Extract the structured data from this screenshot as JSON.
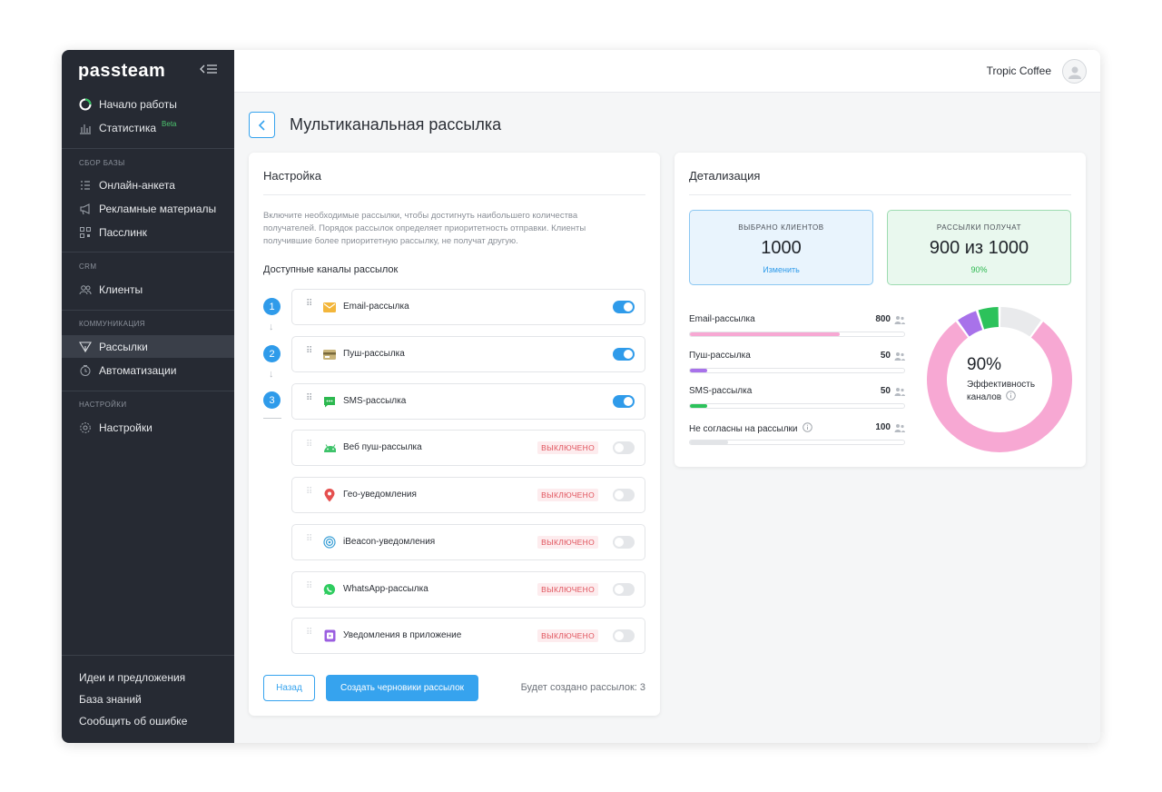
{
  "app": {
    "logo": "passteam",
    "company": "Tropic Coffee"
  },
  "sidebar": {
    "top_items": [
      {
        "label": "Начало работы",
        "icon": "power-icon"
      },
      {
        "label": "Статистика",
        "icon": "bar-chart-icon",
        "badge": "Beta"
      }
    ],
    "sections": [
      {
        "title": "СБОР БАЗЫ",
        "items": [
          {
            "label": "Онлайн-анкета",
            "icon": "form-icon"
          },
          {
            "label": "Рекламные материалы",
            "icon": "megaphone-icon"
          },
          {
            "label": "Пасслинк",
            "icon": "qr-icon"
          }
        ]
      },
      {
        "title": "CRM",
        "items": [
          {
            "label": "Клиенты",
            "icon": "users-icon"
          }
        ]
      },
      {
        "title": "КОММУНИКАЦИЯ",
        "items": [
          {
            "label": "Рассылки",
            "icon": "send-icon",
            "active": true
          },
          {
            "label": "Автоматизации",
            "icon": "automation-icon"
          }
        ]
      },
      {
        "title": "НАСТРОЙКИ",
        "items": [
          {
            "label": "Настройки",
            "icon": "gear-icon"
          }
        ]
      }
    ],
    "footer": [
      "Идеи и предложения",
      "База знаний",
      "Сообщить об ошибке"
    ]
  },
  "page": {
    "title": "Мультиканальная рассылка"
  },
  "settings": {
    "title": "Настройка",
    "description": "Включите необходимые рассылки, чтобы достигнуть наибольшего количества получателей. Порядок рассылок определяет приоритетность отправки. Клиенты получившие более приоритетную рассылку, не получат другую.",
    "subtitle": "Доступные каналы рассылок",
    "steps": [
      "1",
      "2",
      "3"
    ],
    "channels": [
      {
        "name": "Email-рассылка",
        "icon": "email-icon",
        "enabled": true,
        "color": "#f3b63b"
      },
      {
        "name": "Пуш-рассылка",
        "icon": "wallet-card-icon",
        "enabled": true,
        "color": "#b9a26a"
      },
      {
        "name": "SMS-рассылка",
        "icon": "sms-icon",
        "enabled": true,
        "color": "#2cb84f"
      },
      {
        "name": "Веб пуш-рассылка",
        "icon": "android-icon",
        "enabled": false,
        "status": "ВЫКЛЮЧЕНО",
        "color": "#3ec36a"
      },
      {
        "name": "Гео-уведомления",
        "icon": "location-pin-icon",
        "enabled": false,
        "status": "ВЫКЛЮЧЕНО",
        "color": "#e5504f"
      },
      {
        "name": "iBeacon-уведомления",
        "icon": "beacon-icon",
        "enabled": false,
        "status": "ВЫКЛЮЧЕНО",
        "color": "#3a9fd6"
      },
      {
        "name": "WhatsApp-рассылка",
        "icon": "whatsapp-icon",
        "enabled": false,
        "status": "ВЫКЛЮЧЕНО",
        "color": "#2ecc5f"
      },
      {
        "name": "Уведомления в приложение",
        "icon": "app-icon",
        "enabled": false,
        "status": "ВЫКЛЮЧЕНО",
        "color": "#9b5fe0"
      }
    ],
    "back_label": "Назад",
    "create_label": "Создать черновики рассылок",
    "will_create": "Будет создано рассылок: 3"
  },
  "details": {
    "title": "Детализация",
    "selected": {
      "label": "ВЫБРАНО КЛИЕНТОВ",
      "value": "1000",
      "link": "Изменить"
    },
    "receive": {
      "label": "РАССЫЛКИ ПОЛУЧАТ",
      "value": "900 из 1000",
      "pct": "90%"
    },
    "bars": [
      {
        "label": "Email-рассылка",
        "value": "800",
        "fraction": 0.7,
        "color": "#f7a8d3"
      },
      {
        "label": "Пуш-рассылка",
        "value": "50",
        "fraction": 0.08,
        "color": "#a872ea"
      },
      {
        "label": "SMS-рассылка",
        "value": "50",
        "fraction": 0.08,
        "color": "#2cc25b"
      },
      {
        "label": "Не согласны на рассылки",
        "value": "100",
        "fraction": 0.18,
        "color": "#e9eaec",
        "info": true
      }
    ],
    "donut": {
      "percent_text": "90%",
      "label_line1": "Эффективность",
      "label_line2": "каналов",
      "segments": [
        {
          "name": "Email-рассылка",
          "value": 800,
          "color": "#f7a8d3"
        },
        {
          "name": "Пуш-рассылка",
          "value": 50,
          "color": "#a872ea"
        },
        {
          "name": "SMS-рассылка",
          "value": 50,
          "color": "#2cc25b"
        },
        {
          "name": "Не согласны на рассылки",
          "value": 100,
          "color": "#e9eaec"
        }
      ]
    }
  }
}
